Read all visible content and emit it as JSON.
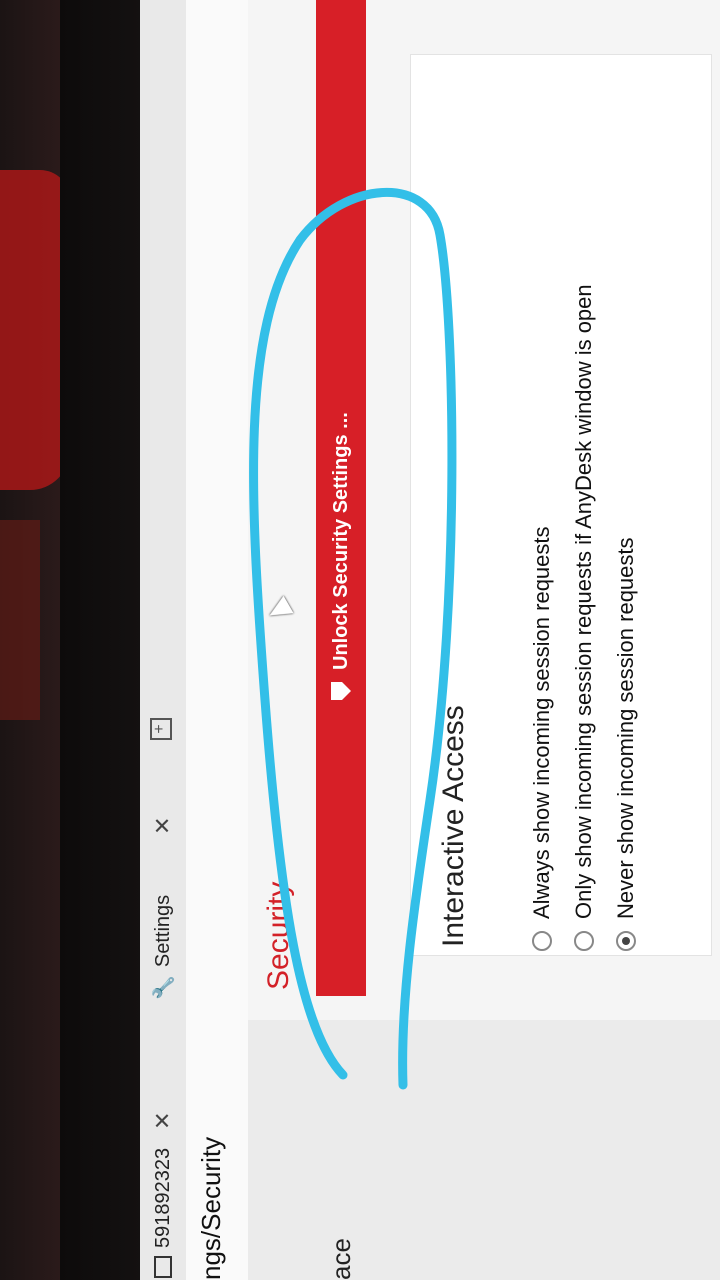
{
  "tabs": [
    {
      "label": "591892323"
    },
    {
      "label": "Settings"
    }
  ],
  "path": "ngs/Security",
  "sidebar_fragment": "ace",
  "page_title": "Security",
  "unlock_button": "Unlock Security Settings ...",
  "interactive_access": {
    "title": "Interactive Access",
    "options": [
      {
        "label": "Always show incoming session requests",
        "selected": false
      },
      {
        "label": "Only show incoming session requests if AnyDesk window is open",
        "selected": false
      },
      {
        "label": "Never show incoming session requests",
        "selected": true
      }
    ]
  },
  "colors": {
    "accent_red": "#d71f27",
    "annotation_blue": "#33bfe8"
  }
}
